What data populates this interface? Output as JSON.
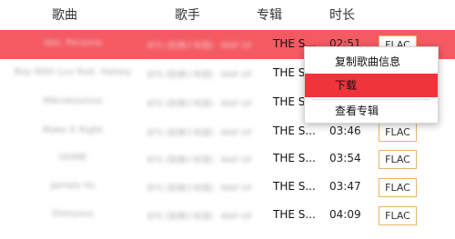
{
  "header": {
    "song": "歌曲",
    "artist": "歌手",
    "album": "专辑",
    "duration": "时长"
  },
  "rows": [
    {
      "song": "Idol, Persona",
      "artist": "BTS (防弹少年团) · MAP OF",
      "album": "THE S...",
      "duration": "02:51",
      "quality": "FLAC",
      "selected": true
    },
    {
      "song": "Boy With Luv feat. Halsey",
      "artist": "BTS (防弹少年团) · MAP OF",
      "album": "THE S...",
      "duration": "",
      "quality": "",
      "selected": false
    },
    {
      "song": "Mikrokosmos",
      "artist": "BTS (防弹少年团) · MAP OF",
      "album": "THE S...",
      "duration": "",
      "quality": "",
      "selected": false
    },
    {
      "song": "Make It Right",
      "artist": "BTS (防弹少年团) · MAP OF",
      "album": "THE S...",
      "duration": "03:46",
      "quality": "FLAC",
      "selected": false
    },
    {
      "song": "HOME",
      "artist": "BTS (防弹少年团) · MAP OF",
      "album": "THE S...",
      "duration": "03:54",
      "quality": "FLAC",
      "selected": false
    },
    {
      "song": "Jamais Vu",
      "artist": "BTS (防弹少年团) · MAP OF",
      "album": "THE S...",
      "duration": "03:47",
      "quality": "FLAC",
      "selected": false
    },
    {
      "song": "Dionysus",
      "artist": "BTS (防弹少年团) · MAP OF",
      "album": "THE S...",
      "duration": "04:09",
      "quality": "FLAC",
      "selected": false
    }
  ],
  "context_menu": {
    "copy_info": "复制歌曲信息",
    "download": "下载",
    "view_album": "查看专辑"
  },
  "colors": {
    "selected_row": "#f45a62",
    "menu_highlight": "#f0343c",
    "quality_border": "#e9b36b"
  }
}
